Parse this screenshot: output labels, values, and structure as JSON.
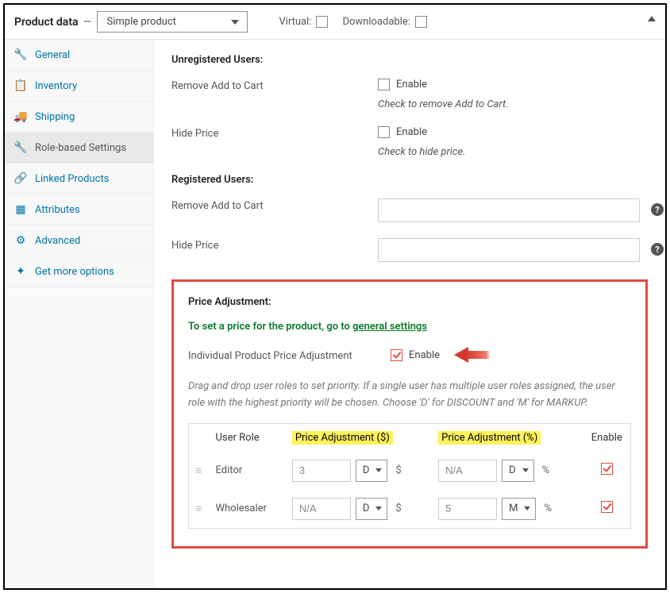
{
  "header": {
    "title": "Product data",
    "type_selected": "Simple product",
    "virtual_label": "Virtual:",
    "downloadable_label": "Downloadable:"
  },
  "sidebar": {
    "items": [
      {
        "label": "General",
        "icon": "wrench"
      },
      {
        "label": "Inventory",
        "icon": "clipboard"
      },
      {
        "label": "Shipping",
        "icon": "truck"
      },
      {
        "label": "Role-based Settings",
        "icon": "wrench",
        "active": true
      },
      {
        "label": "Linked Products",
        "icon": "link"
      },
      {
        "label": "Attributes",
        "icon": "layout"
      },
      {
        "label": "Advanced",
        "icon": "gear"
      },
      {
        "label": "Get more options",
        "icon": "star"
      }
    ]
  },
  "unregistered": {
    "heading": "Unregistered Users:",
    "remove_cart_label": "Remove Add to Cart",
    "remove_cart_enable": "Enable",
    "remove_cart_hint": "Check to remove Add to Cart.",
    "hide_price_label": "Hide Price",
    "hide_price_enable": "Enable",
    "hide_price_hint": "Check to hide price."
  },
  "registered": {
    "heading": "Registered Users:",
    "remove_cart_label": "Remove Add to Cart",
    "hide_price_label": "Hide Price"
  },
  "price_adj": {
    "heading": "Price Adjustment:",
    "green_prefix": "To set a price for the product, go to ",
    "green_link": "general settings",
    "individual_label": "Individual Product Price Adjustment",
    "enable_label": "Enable",
    "drag_hint": "Drag and drop user roles to set priority. If a single user has multiple user roles assigned, the user role with the highest priority will be chosen. Choose 'D' for DISCOUNT and 'M' for MARKUP.",
    "col_role": "User Role",
    "col_adj_dollar": "Price Adjustment ($)",
    "col_adj_percent": "Price Adjustment (%)",
    "col_enable": "Enable",
    "unit_dollar": "$",
    "unit_percent": "%",
    "rows": [
      {
        "role": "Editor",
        "val_dollar": "3",
        "dm_dollar": "D",
        "val_percent": "N/A",
        "dm_percent": "D",
        "enabled": true
      },
      {
        "role": "Wholesaler",
        "val_dollar": "N/A",
        "dm_dollar": "D",
        "val_percent": "5",
        "dm_percent": "M",
        "enabled": true
      }
    ]
  }
}
